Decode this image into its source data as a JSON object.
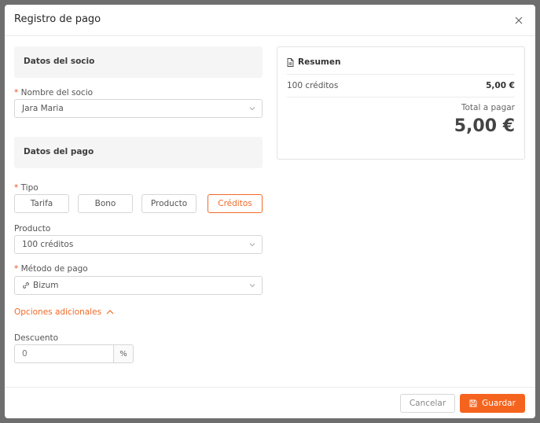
{
  "modal": {
    "title": "Registro de pago"
  },
  "member_section": {
    "title": "Datos del socio",
    "name_label": "Nombre del socio",
    "name_value": "Jara Maria"
  },
  "payment_section": {
    "title": "Datos del pago",
    "type_label": "Tipo",
    "types": [
      "Tarifa",
      "Bono",
      "Producto",
      "Créditos"
    ],
    "selected_type": "Créditos",
    "product_label": "Producto",
    "product_value": "100 créditos",
    "method_label": "Método de pago",
    "method_value": "Bizum",
    "advanced_label": "Opciones adicionales",
    "discount_label": "Descuento",
    "discount_value": "0",
    "discount_unit": "%"
  },
  "summary": {
    "title": "Resumen",
    "item_label": "100 créditos",
    "item_price": "5,00 €",
    "total_label": "Total a pagar",
    "total_value": "5,00 €"
  },
  "footer": {
    "cancel_label": "Cancelar",
    "save_label": "Guardar"
  },
  "colors": {
    "accent": "#f5641e",
    "border": "#d6d6d6"
  }
}
